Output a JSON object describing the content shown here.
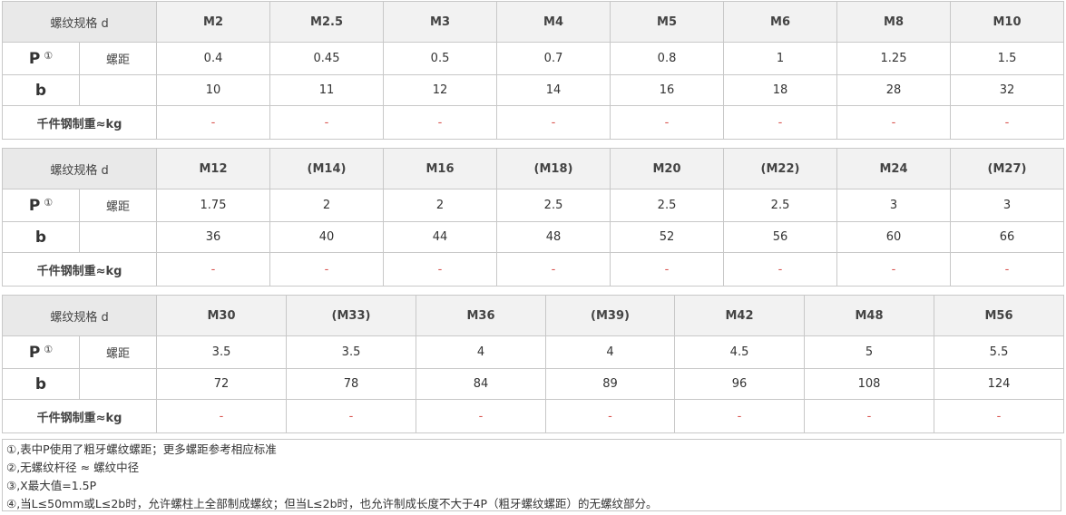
{
  "row_labels": {
    "thread_spec": "螺纹规格 d",
    "pitch_symbol": "P",
    "pitch_note": "①",
    "pitch_label": "螺距",
    "b_symbol": "b",
    "weight_label": "千件钢制重≈kg"
  },
  "table1": {
    "sizes": [
      "M2",
      "M2.5",
      "M3",
      "M4",
      "M5",
      "M6",
      "M8",
      "M10"
    ],
    "pitch": [
      "0.4",
      "0.45",
      "0.5",
      "0.7",
      "0.8",
      "1",
      "1.25",
      "1.5"
    ],
    "b": [
      "10",
      "11",
      "12",
      "14",
      "16",
      "18",
      "28",
      "32"
    ],
    "weight": [
      "-",
      "-",
      "-",
      "-",
      "-",
      "-",
      "-",
      "-"
    ]
  },
  "table2": {
    "sizes": [
      "M12",
      "(M14)",
      "M16",
      "(M18)",
      "M20",
      "(M22)",
      "M24",
      "(M27)"
    ],
    "pitch": [
      "1.75",
      "2",
      "2",
      "2.5",
      "2.5",
      "2.5",
      "3",
      "3"
    ],
    "b": [
      "36",
      "40",
      "44",
      "48",
      "52",
      "56",
      "60",
      "66"
    ],
    "weight": [
      "-",
      "-",
      "-",
      "-",
      "-",
      "-",
      "-",
      "-"
    ]
  },
  "table3": {
    "sizes": [
      "M30",
      "(M33)",
      "M36",
      "(M39)",
      "M42",
      "M48",
      "M56"
    ],
    "pitch": [
      "3.5",
      "3.5",
      "4",
      "4",
      "4.5",
      "5",
      "5.5"
    ],
    "b": [
      "72",
      "78",
      "84",
      "89",
      "96",
      "108",
      "124"
    ],
    "weight": [
      "-",
      "-",
      "-",
      "-",
      "-",
      "-",
      "-"
    ]
  },
  "notes": [
    "①,表中P使用了粗牙螺纹螺距；更多螺距参考相应标准",
    "②,无螺纹杆径 ≈ 螺纹中径",
    "③,X最大值=1.5P",
    "④,当L≤50mm或L≤2b时，允许螺柱上全部制成螺纹；但当L≤2b时，也允许制成长度不大于4P（粗牙螺纹螺距）的无螺纹部分。"
  ],
  "colors": {
    "dash": "#d9534f",
    "border": "#c8c8c8",
    "header_bg": "#f2f2f2"
  }
}
